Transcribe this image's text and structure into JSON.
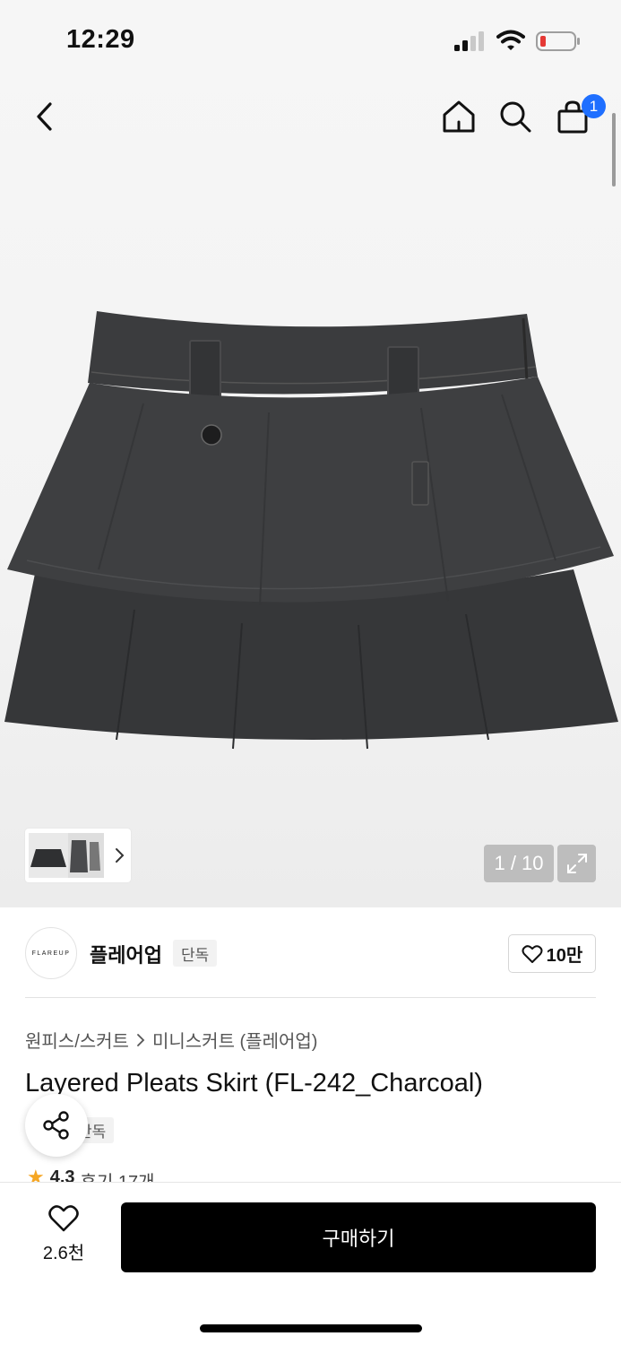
{
  "status_bar": {
    "time": "12:29",
    "battery_color": "#e53935"
  },
  "nav": {
    "back_icon": "chevron-left-icon",
    "home_icon": "home-icon",
    "search_icon": "search-icon",
    "cart_icon": "shopping-bag-icon",
    "cart_badge": "1",
    "cart_badge_color": "#1f6fff"
  },
  "gallery": {
    "page_indicator": "1 / 10",
    "expand_icon": "expand-icon",
    "thumbs_arrow_icon": "chevron-right-icon"
  },
  "brand": {
    "logo_text": "FLAREUP",
    "name": "플레어업",
    "tag": "단독",
    "like_count": "10만"
  },
  "product": {
    "breadcrumb": [
      "원피스/스커트",
      "미니스커트 (플레어업)"
    ],
    "title": "Layered Pleats Skirt (FL-242_Charcoal)",
    "exclusive_tag": "단독",
    "rating": "4.3",
    "review_text": "후기 17개"
  },
  "bottom_bar": {
    "wish_count": "2.6천",
    "buy_label": "구매하기"
  }
}
